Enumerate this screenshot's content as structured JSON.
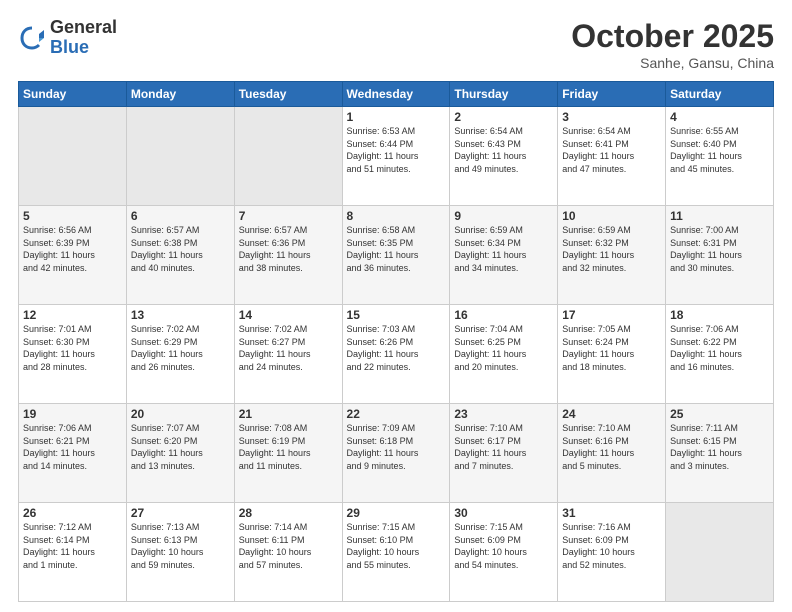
{
  "header": {
    "logo": {
      "general": "General",
      "blue": "Blue"
    },
    "title": "October 2025",
    "subtitle": "Sanhe, Gansu, China"
  },
  "weekdays": [
    "Sunday",
    "Monday",
    "Tuesday",
    "Wednesday",
    "Thursday",
    "Friday",
    "Saturday"
  ],
  "weeks": [
    [
      {
        "day": "",
        "info": ""
      },
      {
        "day": "",
        "info": ""
      },
      {
        "day": "",
        "info": ""
      },
      {
        "day": "1",
        "info": "Sunrise: 6:53 AM\nSunset: 6:44 PM\nDaylight: 11 hours\nand 51 minutes."
      },
      {
        "day": "2",
        "info": "Sunrise: 6:54 AM\nSunset: 6:43 PM\nDaylight: 11 hours\nand 49 minutes."
      },
      {
        "day": "3",
        "info": "Sunrise: 6:54 AM\nSunset: 6:41 PM\nDaylight: 11 hours\nand 47 minutes."
      },
      {
        "day": "4",
        "info": "Sunrise: 6:55 AM\nSunset: 6:40 PM\nDaylight: 11 hours\nand 45 minutes."
      }
    ],
    [
      {
        "day": "5",
        "info": "Sunrise: 6:56 AM\nSunset: 6:39 PM\nDaylight: 11 hours\nand 42 minutes."
      },
      {
        "day": "6",
        "info": "Sunrise: 6:57 AM\nSunset: 6:38 PM\nDaylight: 11 hours\nand 40 minutes."
      },
      {
        "day": "7",
        "info": "Sunrise: 6:57 AM\nSunset: 6:36 PM\nDaylight: 11 hours\nand 38 minutes."
      },
      {
        "day": "8",
        "info": "Sunrise: 6:58 AM\nSunset: 6:35 PM\nDaylight: 11 hours\nand 36 minutes."
      },
      {
        "day": "9",
        "info": "Sunrise: 6:59 AM\nSunset: 6:34 PM\nDaylight: 11 hours\nand 34 minutes."
      },
      {
        "day": "10",
        "info": "Sunrise: 6:59 AM\nSunset: 6:32 PM\nDaylight: 11 hours\nand 32 minutes."
      },
      {
        "day": "11",
        "info": "Sunrise: 7:00 AM\nSunset: 6:31 PM\nDaylight: 11 hours\nand 30 minutes."
      }
    ],
    [
      {
        "day": "12",
        "info": "Sunrise: 7:01 AM\nSunset: 6:30 PM\nDaylight: 11 hours\nand 28 minutes."
      },
      {
        "day": "13",
        "info": "Sunrise: 7:02 AM\nSunset: 6:29 PM\nDaylight: 11 hours\nand 26 minutes."
      },
      {
        "day": "14",
        "info": "Sunrise: 7:02 AM\nSunset: 6:27 PM\nDaylight: 11 hours\nand 24 minutes."
      },
      {
        "day": "15",
        "info": "Sunrise: 7:03 AM\nSunset: 6:26 PM\nDaylight: 11 hours\nand 22 minutes."
      },
      {
        "day": "16",
        "info": "Sunrise: 7:04 AM\nSunset: 6:25 PM\nDaylight: 11 hours\nand 20 minutes."
      },
      {
        "day": "17",
        "info": "Sunrise: 7:05 AM\nSunset: 6:24 PM\nDaylight: 11 hours\nand 18 minutes."
      },
      {
        "day": "18",
        "info": "Sunrise: 7:06 AM\nSunset: 6:22 PM\nDaylight: 11 hours\nand 16 minutes."
      }
    ],
    [
      {
        "day": "19",
        "info": "Sunrise: 7:06 AM\nSunset: 6:21 PM\nDaylight: 11 hours\nand 14 minutes."
      },
      {
        "day": "20",
        "info": "Sunrise: 7:07 AM\nSunset: 6:20 PM\nDaylight: 11 hours\nand 13 minutes."
      },
      {
        "day": "21",
        "info": "Sunrise: 7:08 AM\nSunset: 6:19 PM\nDaylight: 11 hours\nand 11 minutes."
      },
      {
        "day": "22",
        "info": "Sunrise: 7:09 AM\nSunset: 6:18 PM\nDaylight: 11 hours\nand 9 minutes."
      },
      {
        "day": "23",
        "info": "Sunrise: 7:10 AM\nSunset: 6:17 PM\nDaylight: 11 hours\nand 7 minutes."
      },
      {
        "day": "24",
        "info": "Sunrise: 7:10 AM\nSunset: 6:16 PM\nDaylight: 11 hours\nand 5 minutes."
      },
      {
        "day": "25",
        "info": "Sunrise: 7:11 AM\nSunset: 6:15 PM\nDaylight: 11 hours\nand 3 minutes."
      }
    ],
    [
      {
        "day": "26",
        "info": "Sunrise: 7:12 AM\nSunset: 6:14 PM\nDaylight: 11 hours\nand 1 minute."
      },
      {
        "day": "27",
        "info": "Sunrise: 7:13 AM\nSunset: 6:13 PM\nDaylight: 10 hours\nand 59 minutes."
      },
      {
        "day": "28",
        "info": "Sunrise: 7:14 AM\nSunset: 6:11 PM\nDaylight: 10 hours\nand 57 minutes."
      },
      {
        "day": "29",
        "info": "Sunrise: 7:15 AM\nSunset: 6:10 PM\nDaylight: 10 hours\nand 55 minutes."
      },
      {
        "day": "30",
        "info": "Sunrise: 7:15 AM\nSunset: 6:09 PM\nDaylight: 10 hours\nand 54 minutes."
      },
      {
        "day": "31",
        "info": "Sunrise: 7:16 AM\nSunset: 6:09 PM\nDaylight: 10 hours\nand 52 minutes."
      },
      {
        "day": "",
        "info": ""
      }
    ]
  ]
}
